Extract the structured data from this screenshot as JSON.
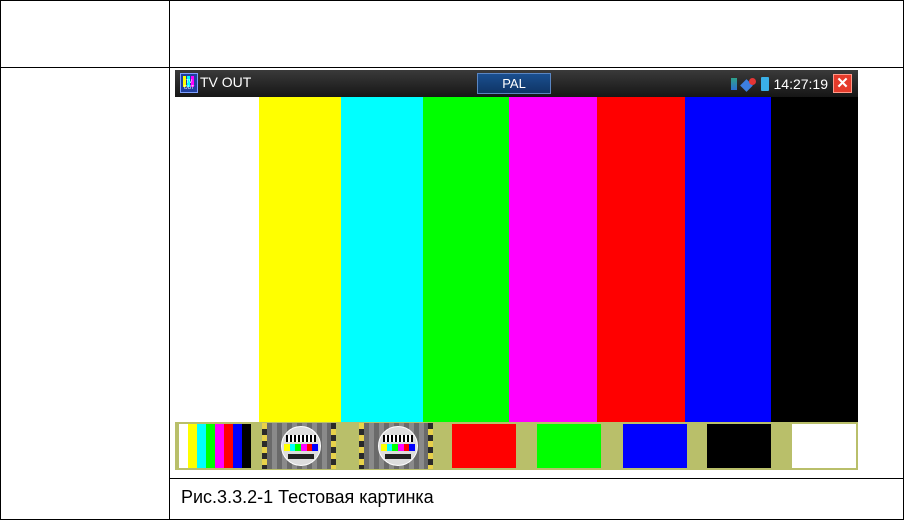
{
  "window": {
    "title": "TV OUT",
    "app_icon_caption": "TV OUT",
    "mode": "PAL",
    "time": "14:27:19",
    "close_symbol": "✕"
  },
  "status_icons": [
    "sd-card-icon",
    "network-icon",
    "battery-icon"
  ],
  "color_bars": [
    "#ffffff",
    "#ffff00",
    "#00ffff",
    "#00ff00",
    "#ff00ff",
    "#ff0000",
    "#0000ff",
    "#000000"
  ],
  "thumbnails": [
    {
      "type": "mini-color-bars",
      "colors": [
        "#ffffff",
        "#ffff00",
        "#00ffff",
        "#00ff00",
        "#ff00ff",
        "#ff0000",
        "#0000ff",
        "#000000"
      ]
    },
    {
      "type": "test-card"
    },
    {
      "type": "test-card"
    },
    {
      "type": "solid",
      "color": "#ff0000"
    },
    {
      "type": "solid",
      "color": "#00ff00"
    },
    {
      "type": "solid",
      "color": "#0000ff"
    },
    {
      "type": "solid",
      "color": "#000000"
    },
    {
      "type": "solid",
      "color": "#ffffff"
    }
  ],
  "caption": "Рис.3.3.2-1  Тестовая картинка",
  "colors": {
    "close_button": "#e53b2b",
    "mode_button": "#1a4f8f",
    "thumb_strip_bg": "#b9bf6a"
  }
}
